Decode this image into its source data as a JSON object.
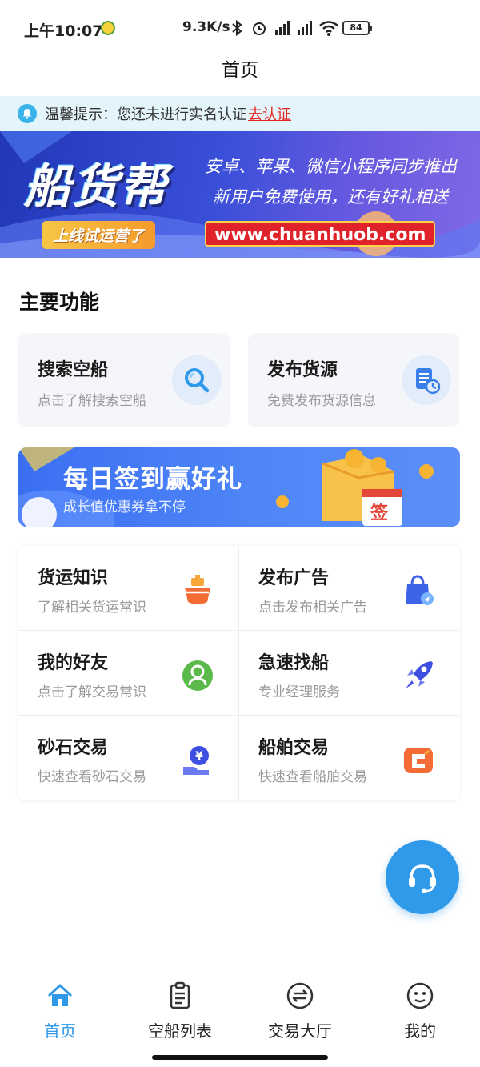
{
  "status_bar": {
    "time": "上午10:07",
    "net_speed": "9.3K/s",
    "battery": "84"
  },
  "header": {
    "title": "首页"
  },
  "notice": {
    "label": "温馨提示：",
    "text": "您还未进行实名认证",
    "link": "去认证"
  },
  "banner": {
    "logo_text": "船货帮",
    "tag": "上线试运营了",
    "line1": "安卓、苹果、微信小程序同步推出",
    "line2": "新用户免费使用，还有好礼相送",
    "url": "www.chuanhuob.com"
  },
  "section": {
    "title": "主要功能"
  },
  "features": [
    {
      "title": "搜索空船",
      "subtitle": "点击了解搜索空船",
      "icon": "search-icon"
    },
    {
      "title": "发布货源",
      "subtitle": "免费发布货源信息",
      "icon": "publish-doc-icon"
    }
  ],
  "checkin": {
    "title": "每日签到赢好礼",
    "subtitle": "成长值优惠券拿不停",
    "badge": "签"
  },
  "grid": [
    {
      "title": "货运知识",
      "subtitle": "了解相关货运常识",
      "icon": "ship-icon"
    },
    {
      "title": "发布广告",
      "subtitle": "点击发布相关广告",
      "icon": "shopping-bag-icon"
    },
    {
      "title": "我的好友",
      "subtitle": "点击了解交易常识",
      "icon": "friend-icon"
    },
    {
      "title": "急速找船",
      "subtitle": "专业经理服务",
      "icon": "rocket-icon"
    },
    {
      "title": "砂石交易",
      "subtitle": "快速查看砂石交易",
      "icon": "yuan-hand-icon"
    },
    {
      "title": "船舶交易",
      "subtitle": "快速查看船舶交易",
      "icon": "exchange-icon"
    }
  ],
  "bottom_nav": [
    {
      "label": "首页",
      "icon": "home-icon",
      "active": true
    },
    {
      "label": "空船列表",
      "icon": "clipboard-list-icon",
      "active": false
    },
    {
      "label": "交易大厅",
      "icon": "swap-icon",
      "active": false
    },
    {
      "label": "我的",
      "icon": "smile-icon",
      "active": false
    }
  ],
  "colors": {
    "accent": "#2f99ea",
    "notice_bg": "#e4f4fb",
    "link_red": "#e5251f",
    "card_bg": "#f4f6fa"
  }
}
